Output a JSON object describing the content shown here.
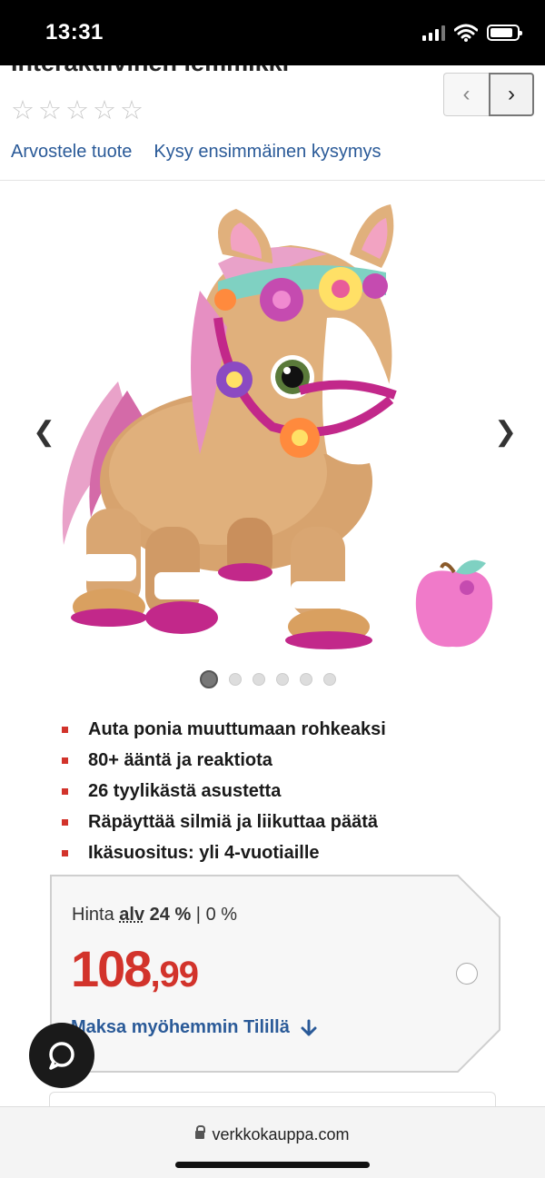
{
  "status_bar": {
    "time": "13:31",
    "icons": [
      "signal-icon",
      "wifi-icon",
      "battery-icon"
    ]
  },
  "header": {
    "title_fragment": "Interaktiivinen lemmikki",
    "rating_stars": 5,
    "links": [
      "Arvostele tuote",
      "Kysy ensimmäinen kysymys"
    ]
  },
  "gallery": {
    "image_count": 6,
    "active_index": 0
  },
  "features": [
    "Auta ponia muuttumaan rohkeaksi",
    "80+ ääntä ja reaktiota",
    "26 tyylikästä asustetta",
    "Räpäyttää silmiä ja liikuttaa päätä",
    "Ikäsuositus: yli 4-vuotiaille"
  ],
  "price": {
    "label_prefix": "Hinta",
    "label_alv": "alv",
    "label_rate": "24 %",
    "label_sep": "|",
    "label_alt": "0 %",
    "euros": "108",
    "cents": ",99",
    "pay_later": "Maksa myöhemmin Tilillä"
  },
  "browser": {
    "url": "verkkokauppa.com"
  },
  "colors": {
    "price_red": "#d2332b",
    "link_blue": "#2a5a98"
  }
}
